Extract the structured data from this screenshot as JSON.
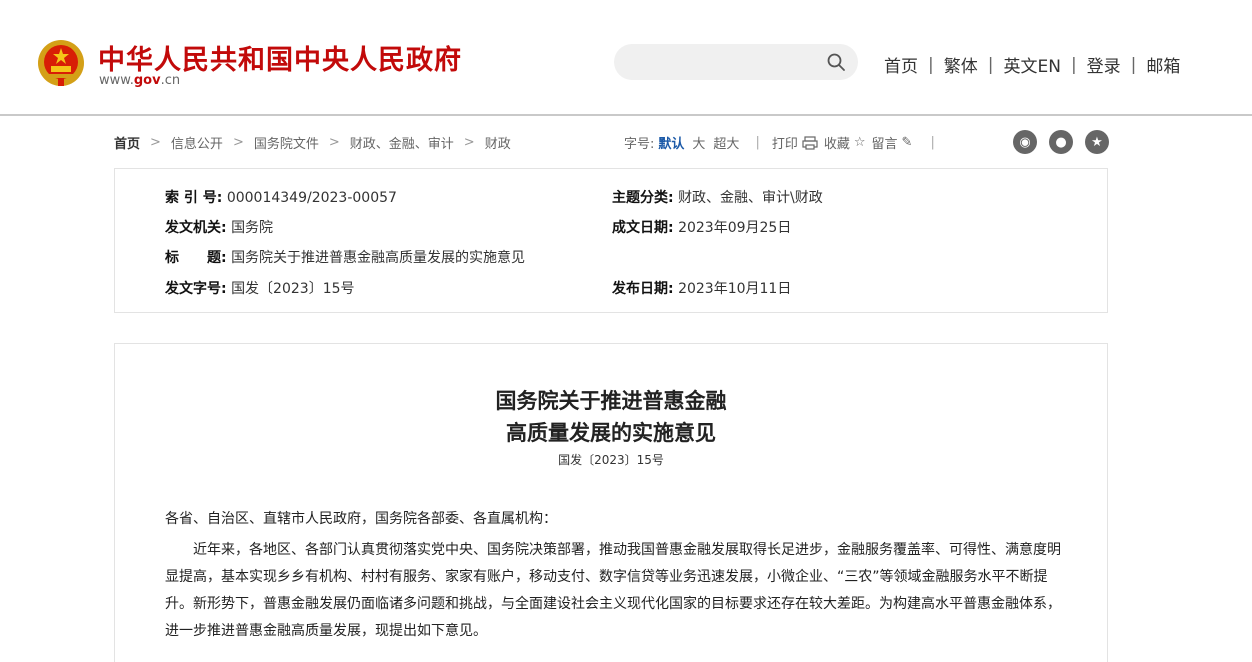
{
  "header": {
    "site_name": "中华人民共和国中央人民政府",
    "site_url_prefix": "www.",
    "site_url_brand": "gov",
    "site_url_suffix": ".cn",
    "nav": [
      "首页",
      "繁体",
      "英文EN",
      "登录",
      "邮箱"
    ],
    "nav_separator": "|",
    "search_placeholder": ""
  },
  "breadcrumb": {
    "items": [
      "首页",
      "信息公开",
      "国务院文件",
      "财政、金融、审计",
      "财政"
    ],
    "arrow": ">"
  },
  "toolbar": {
    "font_size_label": "字号:",
    "font_default": "默认",
    "font_large": "大",
    "font_xlarge": "超大",
    "print": "打印",
    "favorite": "收藏",
    "comment": "留言",
    "separator": "|"
  },
  "meta": {
    "index_label": "索 引 号:",
    "index_value": "000014349/2023-00057",
    "topic_label": "主题分类:",
    "topic_value": "财政、金融、审计\\财政",
    "issuer_label": "发文机关:",
    "issuer_value": "国务院",
    "written_label": "成文日期:",
    "written_value": "2023年09月25日",
    "title_label": "标　　题:",
    "title_value": "国务院关于推进普惠金融高质量发展的实施意见",
    "docno_label": "发文字号:",
    "docno_value": "国发〔2023〕15号",
    "published_label": "发布日期:",
    "published_value": "2023年10月11日"
  },
  "document": {
    "title_line1": "国务院关于推进普惠金融",
    "title_line2": "高质量发展的实施意见",
    "number": "国发〔2023〕15号",
    "salutation": "各省、自治区、直辖市人民政府，国务院各部委、各直属机构：",
    "para1": "近年来，各地区、各部门认真贯彻落实党中央、国务院决策部署，推动我国普惠金融发展取得长足进步，金融服务覆盖率、可得性、满意度明显提高，基本实现乡乡有机构、村村有服务、家家有账户，移动支付、数字信贷等业务迅速发展，小微企业、“三农”等领域金融服务水平不断提升。新形势下，普惠金融发展仍面临诸多问题和挑战，与全面建设社会主义现代化国家的目标要求还存在较大差距。为构建高水平普惠金融体系，进一步推进普惠金融高质量发展，现提出如下意见。"
  },
  "colors": {
    "brand_red": "#c20a0a",
    "link_blue": "#1c5aa8"
  }
}
